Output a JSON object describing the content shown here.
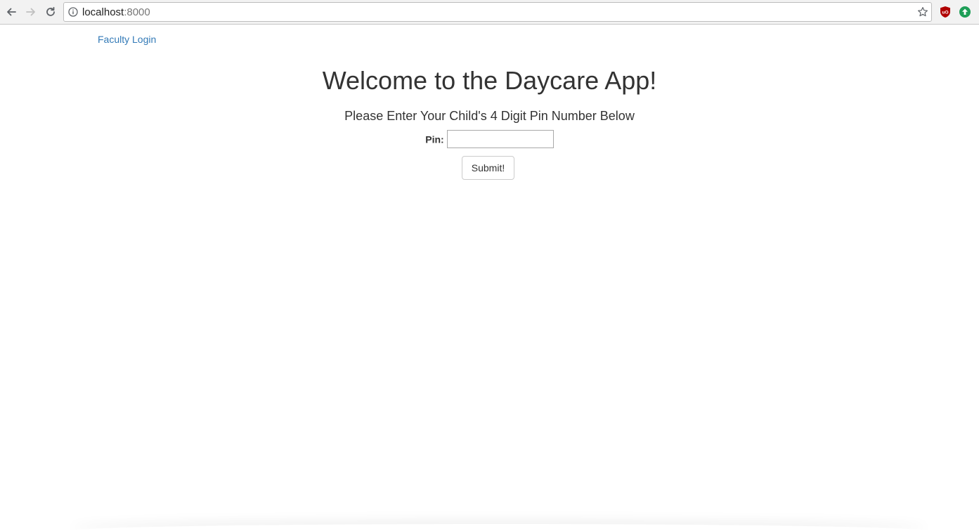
{
  "browser": {
    "url_host": "localhost",
    "url_port": ":8000",
    "icons": {
      "back": "arrow-left-icon",
      "forward": "arrow-right-icon",
      "reload": "reload-icon",
      "info": "info-icon",
      "bookmark": "star-icon",
      "extension_1": "ublock-icon",
      "extension_2": "green-upload-icon"
    },
    "colors": {
      "extension_1": "#b00000",
      "extension_2": "#1e9e57"
    }
  },
  "nav": {
    "faculty_login": "Faculty Login"
  },
  "main": {
    "title": "Welcome to the Daycare App!",
    "subtitle": "Please Enter Your Child's 4 Digit Pin Number Below",
    "pin_label": "Pin:",
    "pin_value": "",
    "submit_label": "Submit!"
  },
  "colors": {
    "link": "#337ab7",
    "text": "#333333"
  }
}
